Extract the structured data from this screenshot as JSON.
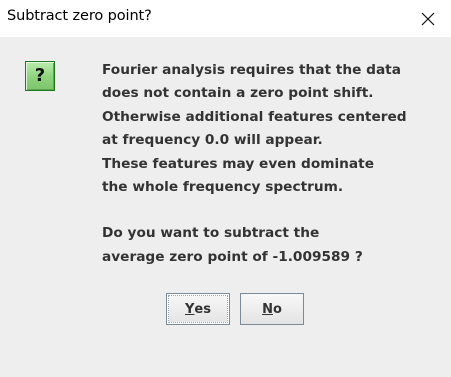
{
  "dialog": {
    "title": "Subtract zero point?",
    "close_icon": "close-icon",
    "icon": "question-icon",
    "icon_glyph": "?",
    "message_lines": [
      "Fourier analysis requires that the data",
      "does not contain a zero point shift.",
      "Otherwise additional features centered",
      "at frequency 0.0 will appear.",
      "These features may even dominate",
      "the whole frequency spectrum."
    ],
    "question_lines": [
      "Do you want to subtract the",
      "average zero point of -1.009589 ?"
    ]
  },
  "buttons": {
    "yes": {
      "mnemonic": "Y",
      "rest": "es",
      "label": "Yes"
    },
    "no": {
      "mnemonic": "N",
      "rest": "o",
      "label": "No"
    }
  },
  "colors": {
    "titlebar": "#ffffff",
    "background": "#eeeeee",
    "text": "#333333",
    "icon_green": "#8ed27e",
    "icon_border": "#1f7a1f",
    "button_border": "#7a8a99"
  }
}
